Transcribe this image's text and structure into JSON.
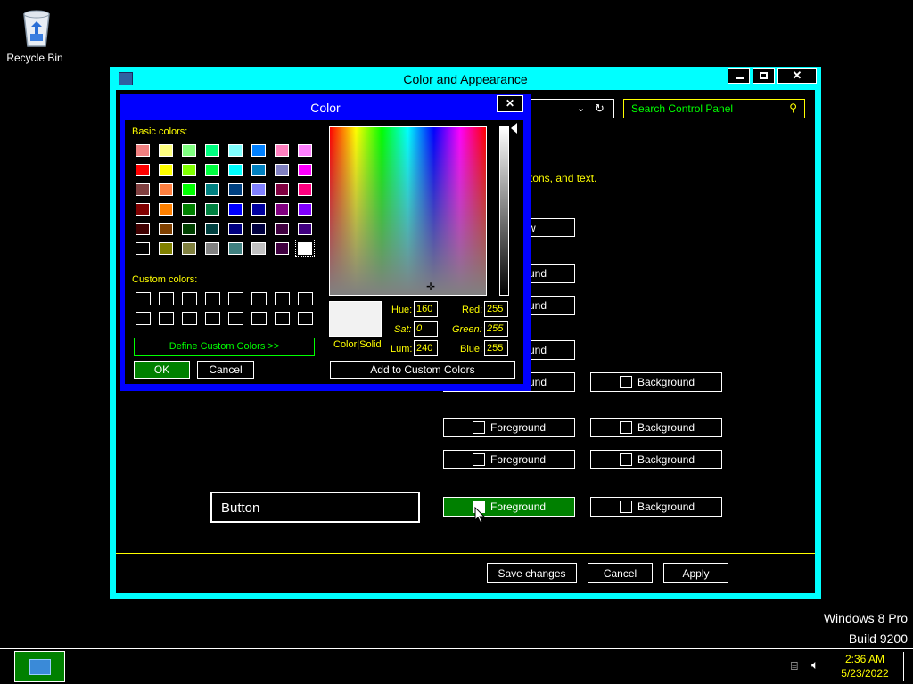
{
  "desktop": {
    "recycle_bin_label": "Recycle Bin",
    "os_name": "Windows 8 Pro",
    "os_build": "Build 9200"
  },
  "taskbar": {
    "time": "2:36 AM",
    "date": "5/23/2022"
  },
  "main_window": {
    "title": "Color and Appearance",
    "search_placeholder": "Search Control Panel",
    "visible_text_fragment": "tons, and text.",
    "partial_labels": [
      "w",
      "und",
      "und",
      "und",
      "und"
    ],
    "rows": [
      {
        "fg": "Foreground",
        "bg": "Background"
      },
      {
        "fg": "Foreground",
        "bg": "Background"
      },
      {
        "fg": "Foreground",
        "bg": "Background"
      },
      {
        "fg": "Foreground",
        "bg": "Background"
      }
    ],
    "button_preview": "Button",
    "save_label": "Save changes",
    "cancel_label": "Cancel",
    "apply_label": "Apply"
  },
  "color_dialog": {
    "title": "Color",
    "basic_colors_label": "Basic colors:",
    "custom_colors_label": "Custom colors:",
    "define_custom_label": "Define Custom Colors >>",
    "ok_label": "OK",
    "cancel_label": "Cancel",
    "add_custom_label": "Add to Custom Colors",
    "color_solid_label": "Color|Solid",
    "hue_label": "Hue:",
    "sat_label": "Sat:",
    "lum_label": "Lum:",
    "red_label": "Red:",
    "green_label": "Green:",
    "blue_label": "Blue:",
    "hue": "160",
    "sat": "0",
    "lum": "240",
    "red": "255",
    "green": "255",
    "blue": "255",
    "basic_colors": [
      [
        "#f08080",
        "#ffff80",
        "#80ff80",
        "#00ff80",
        "#80ffff",
        "#0080ff",
        "#ff80c0",
        "#ff80ff"
      ],
      [
        "#ff0000",
        "#ffff00",
        "#80ff00",
        "#00ff40",
        "#00ffff",
        "#0080c0",
        "#8080c0",
        "#ff00ff"
      ],
      [
        "#804040",
        "#ff8040",
        "#00ff00",
        "#008080",
        "#004080",
        "#8080ff",
        "#800040",
        "#ff0080"
      ],
      [
        "#800000",
        "#ff8000",
        "#008000",
        "#008040",
        "#0000ff",
        "#0000a0",
        "#800080",
        "#8000ff"
      ],
      [
        "#400000",
        "#804000",
        "#004000",
        "#004040",
        "#000080",
        "#000040",
        "#400040",
        "#400080"
      ],
      [
        "#000000",
        "#808000",
        "#808040",
        "#808080",
        "#408080",
        "#c0c0c0",
        "#400040",
        "#ffffff"
      ]
    ]
  }
}
